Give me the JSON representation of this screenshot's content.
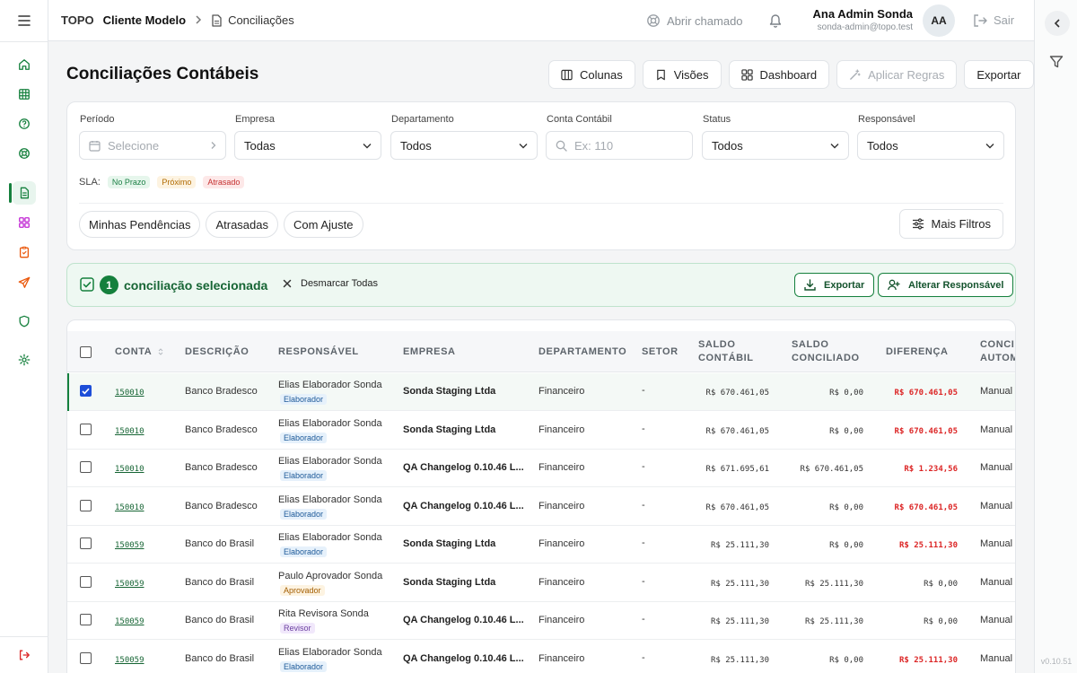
{
  "header": {
    "brand": "TOPO",
    "client": "Cliente Modelo",
    "page": "Conciliações",
    "open_ticket": "Abrir chamado",
    "user_name": "Ana Admin Sonda",
    "user_email": "sonda-admin@topo.test",
    "avatar_initials": "AA",
    "logout": "Sair"
  },
  "sidebar": {
    "items": [
      {
        "icon": "home-icon"
      },
      {
        "icon": "table-icon"
      },
      {
        "icon": "help-circle-icon"
      },
      {
        "icon": "lifebuoy-icon"
      },
      {
        "icon": "document-icon",
        "active": true
      },
      {
        "icon": "grid-icon"
      },
      {
        "icon": "clipboard-check-icon"
      },
      {
        "icon": "send-icon"
      },
      {
        "icon": "shield-icon"
      },
      {
        "icon": "gear-icon"
      }
    ],
    "logout_icon": "logout-icon"
  },
  "page": {
    "title": "Conciliações Contábeis",
    "toolbar": {
      "columns": "Colunas",
      "views": "Visões",
      "dashboard": "Dashboard",
      "apply_rules": "Aplicar Regras",
      "export": "Exportar"
    }
  },
  "filters": {
    "period": {
      "label": "Período",
      "placeholder": "Selecione"
    },
    "company": {
      "label": "Empresa",
      "value": "Todas"
    },
    "department": {
      "label": "Departamento",
      "value": "Todos"
    },
    "account": {
      "label": "Conta Contábil",
      "placeholder": "Ex: 110"
    },
    "status": {
      "label": "Status",
      "value": "Todos"
    },
    "owner": {
      "label": "Responsável",
      "value": "Todos"
    },
    "sla": {
      "label": "SLA:",
      "on_time": "No Prazo",
      "near": "Próximo",
      "late": "Atrasado"
    },
    "chips": {
      "mine": "Minhas Pendências",
      "late": "Atrasadas",
      "adjust": "Com Ajuste"
    },
    "more": "Mais Filtros"
  },
  "selection": {
    "count": "1",
    "text": "conciliação selecionada",
    "clear": "Desmarcar Todas",
    "export": "Exportar",
    "change_owner": "Alterar Responsável"
  },
  "table": {
    "columns": {
      "conta": "CONTA",
      "descricao": "DESCRIÇÃO",
      "responsavel": "RESPONSÁVEL",
      "empresa": "EMPRESA",
      "departamento": "DEPARTAMENTO",
      "setor": "SETOR",
      "saldo_contabil_1": "SALDO",
      "saldo_contabil_2": "CONTÁBIL",
      "saldo_conciliado_1": "SALDO",
      "saldo_conciliado_2": "CONCILIADO",
      "diferenca": "DIFERENÇA",
      "concil_1": "CONCIL",
      "concil_2": "AUTOM"
    },
    "rows": [
      {
        "selected": true,
        "conta": "150010",
        "descricao": "Banco Bradesco",
        "responsavel": "Elias Elaborador Sonda",
        "role": "Elaborador",
        "empresa": "Sonda Staging Ltda",
        "departamento": "Financeiro",
        "setor": "-",
        "saldo_contabil": "R$ 670.461,05",
        "saldo_conciliado": "R$ 0,00",
        "diferenca": "R$ 670.461,05",
        "diff_red": true,
        "concil": "Manual"
      },
      {
        "selected": false,
        "conta": "150010",
        "descricao": "Banco Bradesco",
        "responsavel": "Elias Elaborador Sonda",
        "role": "Elaborador",
        "empresa": "Sonda Staging Ltda",
        "departamento": "Financeiro",
        "setor": "-",
        "saldo_contabil": "R$ 670.461,05",
        "saldo_conciliado": "R$ 0,00",
        "diferenca": "R$ 670.461,05",
        "diff_red": true,
        "concil": "Manual"
      },
      {
        "selected": false,
        "conta": "150010",
        "descricao": "Banco Bradesco",
        "responsavel": "Elias Elaborador Sonda",
        "role": "Elaborador",
        "empresa": "QA Changelog 0.10.46 L...",
        "departamento": "Financeiro",
        "setor": "-",
        "saldo_contabil": "R$ 671.695,61",
        "saldo_conciliado": "R$ 670.461,05",
        "diferenca": "R$ 1.234,56",
        "diff_red": true,
        "concil": "Manual"
      },
      {
        "selected": false,
        "conta": "150010",
        "descricao": "Banco Bradesco",
        "responsavel": "Elias Elaborador Sonda",
        "role": "Elaborador",
        "empresa": "QA Changelog 0.10.46 L...",
        "departamento": "Financeiro",
        "setor": "-",
        "saldo_contabil": "R$ 670.461,05",
        "saldo_conciliado": "R$ 0,00",
        "diferenca": "R$ 670.461,05",
        "diff_red": true,
        "concil": "Manual"
      },
      {
        "selected": false,
        "conta": "150059",
        "descricao": "Banco do Brasil",
        "responsavel": "Elias Elaborador Sonda",
        "role": "Elaborador",
        "empresa": "Sonda Staging Ltda",
        "departamento": "Financeiro",
        "setor": "-",
        "saldo_contabil": "R$ 25.111,30",
        "saldo_conciliado": "R$ 0,00",
        "diferenca": "R$ 25.111,30",
        "diff_red": true,
        "concil": "Manual"
      },
      {
        "selected": false,
        "conta": "150059",
        "descricao": "Banco do Brasil",
        "responsavel": "Paulo Aprovador Sonda",
        "role": "Aprovador",
        "empresa": "Sonda Staging Ltda",
        "departamento": "Financeiro",
        "setor": "-",
        "saldo_contabil": "R$ 25.111,30",
        "saldo_conciliado": "R$ 25.111,30",
        "diferenca": "R$ 0,00",
        "diff_red": false,
        "concil": "Manual"
      },
      {
        "selected": false,
        "conta": "150059",
        "descricao": "Banco do Brasil",
        "responsavel": "Rita Revisora Sonda",
        "role": "Revisor",
        "empresa": "QA Changelog 0.10.46 L...",
        "departamento": "Financeiro",
        "setor": "-",
        "saldo_contabil": "R$ 25.111,30",
        "saldo_conciliado": "R$ 25.111,30",
        "diferenca": "R$ 0,00",
        "diff_red": false,
        "concil": "Manual"
      },
      {
        "selected": false,
        "conta": "150059",
        "descricao": "Banco do Brasil",
        "responsavel": "Elias Elaborador Sonda",
        "role": "Elaborador",
        "empresa": "QA Changelog 0.10.46 L...",
        "departamento": "Financeiro",
        "setor": "-",
        "saldo_contabil": "R$ 25.111,30",
        "saldo_conciliado": "R$ 0,00",
        "diferenca": "R$ 25.111,30",
        "diff_red": true,
        "concil": "Manual"
      }
    ]
  },
  "version": "v0.10.51",
  "colors": {
    "accent": "#15803d",
    "danger": "#dc2626",
    "checkbox": "#1d4ed8"
  }
}
